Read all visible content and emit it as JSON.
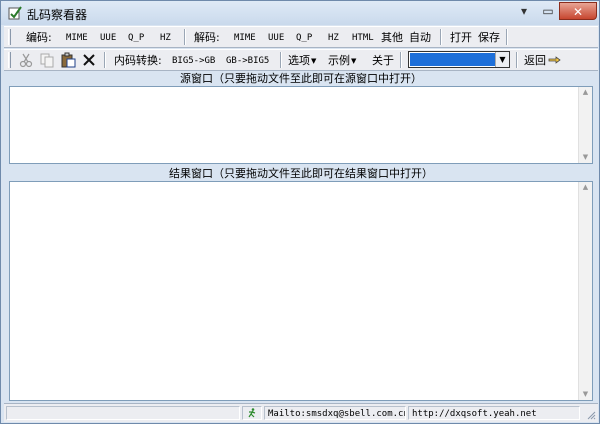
{
  "window": {
    "title": "乱码察看器",
    "controls": {
      "minimize": "▾",
      "maximize": "▭",
      "close": "✕"
    }
  },
  "toolbar1": {
    "encode_label": "编码:",
    "encode_items": [
      "MIME",
      "UUE",
      "Q_P",
      "HZ"
    ],
    "decode_label": "解码:",
    "decode_items": [
      "MIME",
      "UUE",
      "Q_P",
      "HZ",
      "HTML",
      "其他",
      "自动"
    ],
    "file_items": [
      "打开",
      "保存"
    ]
  },
  "toolbar2": {
    "edit_icons": [
      "scissors-icon",
      "copy-icon",
      "paste-icon",
      "delete-icon"
    ],
    "convert_label": "内码转换:",
    "convert_items": [
      "BIG5->GB",
      "GB->BIG5"
    ],
    "menus": [
      "选项",
      "示例",
      "关于"
    ],
    "combo_value": "",
    "back_label": "返回"
  },
  "panes": {
    "source_title": "源窗口（只要拖动文件至此即可在源窗口中打开）",
    "source_text": "",
    "result_title": "结果窗口（只要拖动文件至此即可在结果窗口中打开）",
    "result_text": ""
  },
  "statusbar": {
    "mail": "Mailto:smsdxq@sbell.com.cn",
    "url": "http://dxqsoft.yeah.net"
  },
  "colors": {
    "window_bg": "#d9e4f1",
    "toolbar_bg": "#ecedf1",
    "combo_selection": "#1e6fd9",
    "close_button": "#c7462f"
  }
}
